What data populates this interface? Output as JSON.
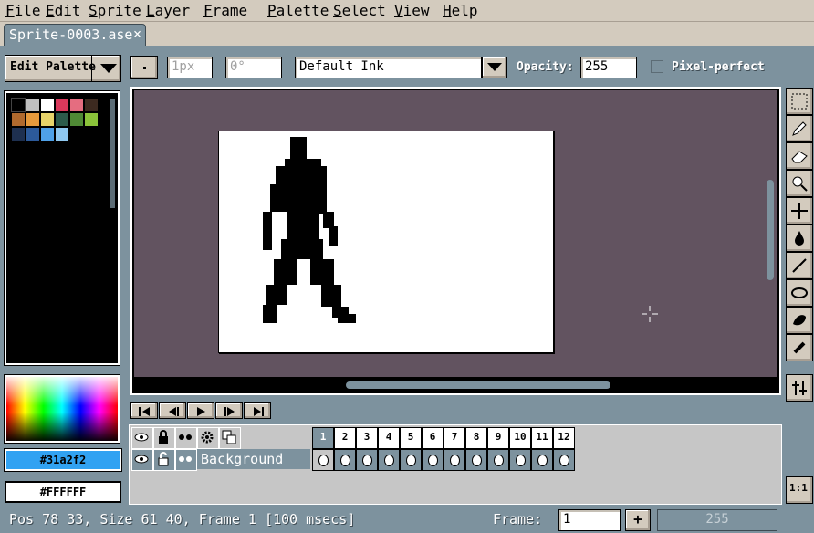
{
  "menu": {
    "items": [
      "File",
      "Edit",
      "Sprite",
      "Layer",
      "Frame",
      "Palette",
      "Select",
      "View",
      "Help"
    ]
  },
  "tab": {
    "title": "Sprite-0003.ase",
    "close": "×"
  },
  "toolbar": {
    "edit_palette": "Edit Palette",
    "brush_size": "1px",
    "brush_angle": "0°",
    "ink": "Default Ink",
    "opacity_label": "Opacity:",
    "opacity_value": "255",
    "pixel_perfect": "Pixel-perfect"
  },
  "palette": {
    "colors": [
      "#000000",
      "#c0c0c0",
      "#ffffff",
      "#d9395b",
      "#e56d80",
      "#3d2a20",
      "#b06a2e",
      "#e69a3c",
      "#e8d46a",
      "#2c5a4a",
      "#4f8a35",
      "#8bc33a",
      "#1e3050",
      "#2c5a9a",
      "#4fa1e8",
      "#8fc8f0"
    ]
  },
  "colors": {
    "fg_hex": "#31a2f2",
    "bg_hex": "#FFFFFF",
    "fg_color": "#31a2f2",
    "canvas_bg": "#625360"
  },
  "timeline": {
    "frames": [
      "1",
      "2",
      "3",
      "4",
      "5",
      "6",
      "7",
      "8",
      "9",
      "10",
      "11",
      "12"
    ],
    "layer_name": "Background"
  },
  "status": {
    "text": "Pos 78 33, Size 61 40, Frame 1 [100 msecs]",
    "frame_label": "Frame:",
    "frame_value": "1",
    "add": "+",
    "alpha_value": "255"
  },
  "icons": {
    "tools": [
      "marquee-icon",
      "pencil-icon",
      "eraser-icon",
      "eyedropper-icon",
      "move-icon",
      "fill-icon",
      "line-icon",
      "ellipse-icon",
      "blur-icon",
      "spray-icon"
    ]
  }
}
